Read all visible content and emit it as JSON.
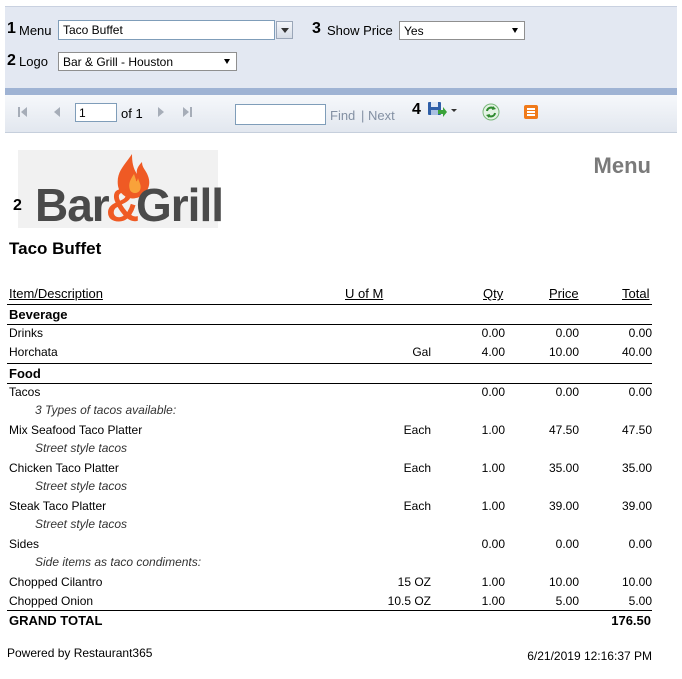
{
  "params": {
    "menu": {
      "num": "1",
      "label": "Menu",
      "value": "Taco Buffet"
    },
    "show_price": {
      "num": "3",
      "label": "Show Price",
      "value": "Yes"
    },
    "logo": {
      "num": "2",
      "label": "Logo",
      "value": "Bar & Grill - Houston"
    }
  },
  "toolbar": {
    "page_value": "1",
    "of_pages": "of 1",
    "find_label": "Find",
    "separator": "|",
    "next_label": "Next",
    "export_num": "4"
  },
  "report": {
    "heading": "Menu",
    "logo_num": "2",
    "logo_text_left": "Bar",
    "logo_text_amp": "&",
    "logo_text_right": "Grill",
    "menu_name": "Taco Buffet",
    "columns": {
      "item": "Item/Description",
      "uom": "U of M",
      "qty": "Qty",
      "price": "Price",
      "total": "Total"
    },
    "categories": [
      {
        "name": "Beverage",
        "rows": [
          {
            "item": "Drinks",
            "uom": "",
            "qty": "0.00",
            "price": "0.00",
            "total": "0.00",
            "note": ""
          },
          {
            "item": "Horchata",
            "uom": "Gal",
            "qty": "4.00",
            "price": "10.00",
            "total": "40.00",
            "note": ""
          }
        ]
      },
      {
        "name": "Food",
        "rows": [
          {
            "item": "Tacos",
            "uom": "",
            "qty": "0.00",
            "price": "0.00",
            "total": "0.00",
            "note": "3 Types of tacos available:"
          },
          {
            "item": "Mix Seafood Taco Platter",
            "uom": "Each",
            "qty": "1.00",
            "price": "47.50",
            "total": "47.50",
            "note": "Street style tacos"
          },
          {
            "item": "Chicken Taco Platter",
            "uom": "Each",
            "qty": "1.00",
            "price": "35.00",
            "total": "35.00",
            "note": "Street style tacos"
          },
          {
            "item": "Steak Taco Platter",
            "uom": "Each",
            "qty": "1.00",
            "price": "39.00",
            "total": "39.00",
            "note": "Street style tacos"
          },
          {
            "item": "Sides",
            "uom": "",
            "qty": "0.00",
            "price": "0.00",
            "total": "0.00",
            "note": "Side items as taco condiments:"
          },
          {
            "item": "Chopped Cilantro",
            "uom": "15 OZ",
            "qty": "1.00",
            "price": "10.00",
            "total": "10.00",
            "note": ""
          },
          {
            "item": "Chopped Onion",
            "uom": "10.5 OZ",
            "qty": "1.00",
            "price": "5.00",
            "total": "5.00",
            "note": ""
          }
        ]
      }
    ],
    "grand_total_label": "GRAND TOTAL",
    "grand_total_value": "176.50",
    "powered_by": "Powered by Restaurant365",
    "timestamp": "6/21/2019 12:16:37 PM"
  }
}
